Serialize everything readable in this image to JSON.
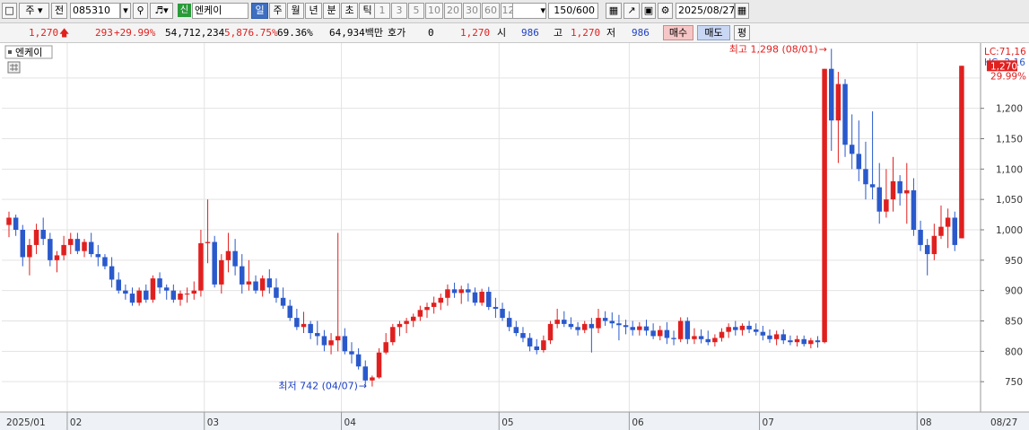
{
  "toolbar": {
    "market_label": "주",
    "prev_label": "전",
    "stock_code": "085310",
    "new_badge": "신",
    "stock_name": "엔케이",
    "period_tabs": [
      "일",
      "주",
      "월",
      "년",
      "분",
      "초",
      "틱"
    ],
    "interval_options": [
      "1",
      "3",
      "5",
      "10",
      "20",
      "30",
      "60",
      "120"
    ],
    "count_display": "150/600",
    "date_value": "2025/08/27"
  },
  "quote": {
    "price": "1,270",
    "change": "293",
    "change_pct": "+29.99%",
    "volume": "54,712,234",
    "volume_ratio": "5,876.75%",
    "turnover_pct": "69.36%",
    "amount": "64,934백만",
    "hoga_label": "호가",
    "hoga_value": "0",
    "hoga_price": "1,270",
    "open_label": "시",
    "open_value": "986",
    "high_label": "고",
    "high_value": "1,270",
    "low_label": "저",
    "low_value": "986",
    "buy_button": "매수",
    "sell_button": "매도",
    "eval_button": "평"
  },
  "chart_panel": {
    "legend_name": "엔케이",
    "lc_label": "LC:71,16",
    "hc_label": "HC:-2,16",
    "current_price_tag": "1,270",
    "current_pct_tag": "29.99%",
    "max_annotation": "최고 1,298 (08/01)",
    "min_annotation": "최저 742 (04/07)"
  },
  "colors": {
    "up": "#e0201f",
    "down": "#2a59cc",
    "accent": "#3d6fc2",
    "grid": "#e3e3e3"
  },
  "chart_data": {
    "type": "candlestick",
    "y_ticks": [
      750,
      800,
      850,
      900,
      950,
      1000,
      1050,
      1100,
      1150,
      1200,
      1250
    ],
    "y_range": [
      700,
      1300
    ],
    "x_labels": [
      "2025/01",
      "02",
      "03",
      "04",
      "05",
      "06",
      "07",
      "08",
      "08/27"
    ],
    "x_label_bar_index": [
      0,
      9,
      29,
      49,
      72,
      91,
      110,
      133,
      155
    ],
    "candles": [
      [
        1008,
        1030,
        988,
        1020
      ],
      [
        1020,
        1025,
        990,
        1000
      ],
      [
        1000,
        1008,
        940,
        955
      ],
      [
        955,
        985,
        925,
        975
      ],
      [
        975,
        1010,
        960,
        1000
      ],
      [
        1000,
        1020,
        975,
        985
      ],
      [
        985,
        995,
        940,
        950
      ],
      [
        950,
        965,
        930,
        958
      ],
      [
        958,
        990,
        950,
        975
      ],
      [
        975,
        995,
        960,
        985
      ],
      [
        985,
        995,
        960,
        965
      ],
      [
        965,
        985,
        955,
        980
      ],
      [
        980,
        995,
        955,
        960
      ],
      [
        960,
        975,
        940,
        955
      ],
      [
        955,
        960,
        935,
        940
      ],
      [
        940,
        955,
        905,
        918
      ],
      [
        918,
        930,
        895,
        900
      ],
      [
        900,
        910,
        885,
        895
      ],
      [
        895,
        905,
        875,
        880
      ],
      [
        880,
        905,
        875,
        900
      ],
      [
        900,
        910,
        880,
        885
      ],
      [
        885,
        925,
        880,
        920
      ],
      [
        920,
        930,
        895,
        905
      ],
      [
        905,
        910,
        885,
        900
      ],
      [
        900,
        910,
        880,
        885
      ],
      [
        885,
        900,
        875,
        895
      ],
      [
        895,
        905,
        880,
        895
      ],
      [
        895,
        915,
        885,
        900
      ],
      [
        900,
        1000,
        890,
        978
      ],
      [
        978,
        1050,
        945,
        980
      ],
      [
        980,
        990,
        905,
        910
      ],
      [
        910,
        960,
        895,
        950
      ],
      [
        950,
        995,
        930,
        965
      ],
      [
        965,
        985,
        925,
        940
      ],
      [
        940,
        960,
        895,
        910
      ],
      [
        910,
        950,
        900,
        915
      ],
      [
        915,
        925,
        895,
        900
      ],
      [
        900,
        925,
        890,
        920
      ],
      [
        920,
        935,
        895,
        905
      ],
      [
        905,
        920,
        880,
        888
      ],
      [
        888,
        905,
        870,
        875
      ],
      [
        875,
        885,
        850,
        855
      ],
      [
        855,
        870,
        835,
        840
      ],
      [
        840,
        865,
        830,
        845
      ],
      [
        845,
        850,
        820,
        830
      ],
      [
        830,
        850,
        810,
        825
      ],
      [
        825,
        835,
        800,
        810
      ],
      [
        810,
        830,
        795,
        818
      ],
      [
        818,
        995,
        800,
        825
      ],
      [
        825,
        838,
        795,
        800
      ],
      [
        800,
        815,
        780,
        795
      ],
      [
        795,
        805,
        770,
        775
      ],
      [
        775,
        785,
        745,
        752
      ],
      [
        752,
        760,
        742,
        757
      ],
      [
        757,
        805,
        755,
        798
      ],
      [
        798,
        830,
        795,
        815
      ],
      [
        815,
        845,
        810,
        840
      ],
      [
        840,
        850,
        825,
        845
      ],
      [
        845,
        855,
        830,
        850
      ],
      [
        850,
        862,
        840,
        857
      ],
      [
        857,
        875,
        850,
        868
      ],
      [
        868,
        880,
        855,
        873
      ],
      [
        873,
        890,
        862,
        880
      ],
      [
        880,
        895,
        868,
        888
      ],
      [
        888,
        910,
        875,
        902
      ],
      [
        902,
        913,
        888,
        896
      ],
      [
        896,
        908,
        878,
        902
      ],
      [
        902,
        912,
        882,
        897
      ],
      [
        897,
        905,
        875,
        880
      ],
      [
        880,
        903,
        875,
        898
      ],
      [
        898,
        906,
        868,
        873
      ],
      [
        873,
        888,
        855,
        870
      ],
      [
        870,
        880,
        850,
        855
      ],
      [
        855,
        866,
        833,
        840
      ],
      [
        840,
        850,
        825,
        830
      ],
      [
        830,
        840,
        815,
        822
      ],
      [
        822,
        830,
        800,
        808
      ],
      [
        808,
        820,
        795,
        802
      ],
      [
        802,
        826,
        798,
        818
      ],
      [
        818,
        850,
        812,
        845
      ],
      [
        845,
        870,
        838,
        852
      ],
      [
        852,
        866,
        840,
        845
      ],
      [
        845,
        856,
        836,
        840
      ],
      [
        840,
        848,
        826,
        835
      ],
      [
        835,
        850,
        830,
        845
      ],
      [
        845,
        855,
        798,
        838
      ],
      [
        838,
        870,
        830,
        855
      ],
      [
        855,
        866,
        842,
        850
      ],
      [
        850,
        864,
        838,
        846
      ],
      [
        846,
        860,
        818,
        843
      ],
      [
        843,
        852,
        828,
        840
      ],
      [
        840,
        850,
        826,
        835
      ],
      [
        835,
        848,
        826,
        841
      ],
      [
        841,
        852,
        826,
        834
      ],
      [
        834,
        846,
        820,
        825
      ],
      [
        825,
        842,
        818,
        835
      ],
      [
        835,
        848,
        812,
        822
      ],
      [
        822,
        834,
        810,
        820
      ],
      [
        820,
        856,
        815,
        850
      ],
      [
        850,
        856,
        812,
        820
      ],
      [
        820,
        838,
        812,
        825
      ],
      [
        825,
        836,
        813,
        820
      ],
      [
        820,
        834,
        810,
        815
      ],
      [
        815,
        828,
        808,
        822
      ],
      [
        822,
        838,
        816,
        832
      ],
      [
        832,
        846,
        822,
        840
      ],
      [
        840,
        850,
        826,
        835
      ],
      [
        835,
        846,
        826,
        842
      ],
      [
        842,
        850,
        830,
        836
      ],
      [
        836,
        846,
        826,
        832
      ],
      [
        832,
        842,
        818,
        826
      ],
      [
        826,
        836,
        814,
        820
      ],
      [
        820,
        834,
        810,
        828
      ],
      [
        828,
        836,
        812,
        818
      ],
      [
        818,
        826,
        810,
        815
      ],
      [
        815,
        826,
        808,
        820
      ],
      [
        820,
        826,
        808,
        812
      ],
      [
        812,
        822,
        805,
        818
      ],
      [
        818,
        825,
        806,
        815
      ],
      [
        815,
        1265,
        813,
        1265
      ],
      [
        1265,
        1298,
        1130,
        1180
      ],
      [
        1180,
        1260,
        1110,
        1240
      ],
      [
        1240,
        1248,
        1120,
        1140
      ],
      [
        1140,
        1190,
        1100,
        1125
      ],
      [
        1125,
        1180,
        1080,
        1100
      ],
      [
        1100,
        1145,
        1050,
        1075
      ],
      [
        1075,
        1195,
        1050,
        1070
      ],
      [
        1070,
        1110,
        1010,
        1030
      ],
      [
        1030,
        1100,
        1020,
        1050
      ],
      [
        1050,
        1120,
        1030,
        1080
      ],
      [
        1080,
        1090,
        1040,
        1060
      ],
      [
        1060,
        1110,
        1010,
        1065
      ],
      [
        1065,
        1085,
        990,
        1000
      ],
      [
        1000,
        1015,
        965,
        975
      ],
      [
        975,
        985,
        925,
        960
      ],
      [
        960,
        1010,
        950,
        990
      ],
      [
        990,
        1040,
        985,
        1005
      ],
      [
        1005,
        1035,
        970,
        1020
      ],
      [
        1020,
        1030,
        965,
        975
      ],
      [
        986,
        1270,
        986,
        1270
      ]
    ]
  }
}
